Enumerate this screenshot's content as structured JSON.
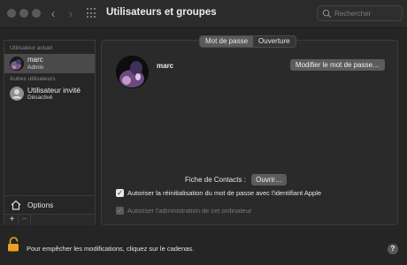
{
  "window": {
    "title": "Utilisateurs et groupes",
    "search_placeholder": "Rechercher"
  },
  "sidebar": {
    "current_user_label": "Utilisateur actuel",
    "other_users_label": "Autres utilisateurs",
    "users": [
      {
        "name": "marc",
        "role": "Admin",
        "selected": true
      },
      {
        "name": "Utilisateur invité",
        "role": "Désactivé",
        "selected": false
      }
    ],
    "options_label": "Options",
    "add_label": "+",
    "remove_label": "−"
  },
  "main": {
    "tabs": [
      {
        "label": "Mot de passe",
        "active": true
      },
      {
        "label": "Ouverture",
        "active": false
      }
    ],
    "user_name": "marc",
    "change_password_label": "Modifier le mot de passe…",
    "contacts_label": "Fiche de Contacts :",
    "open_label": "Ouvrir…",
    "checkboxes": [
      {
        "label": "Autoriser la réinitialisation du mot de passe avec l'identifiant Apple",
        "checked": true,
        "enabled": true
      },
      {
        "label": "Autoriser l'administration de cet ordinateur",
        "checked": true,
        "enabled": false
      }
    ]
  },
  "footer": {
    "lock_text": "Pour empêcher les modifications, cliquez sur le cadenas.",
    "help_label": "?"
  },
  "icons": {
    "back": "chevron-left-icon",
    "forward": "chevron-right-icon",
    "grid": "grid-icon",
    "search": "search-icon",
    "home": "home-icon",
    "lock": "lock-icon"
  },
  "colors": {
    "background": "#252525",
    "selection": "#4a4a4a",
    "lock_orange": "#f0a020"
  }
}
